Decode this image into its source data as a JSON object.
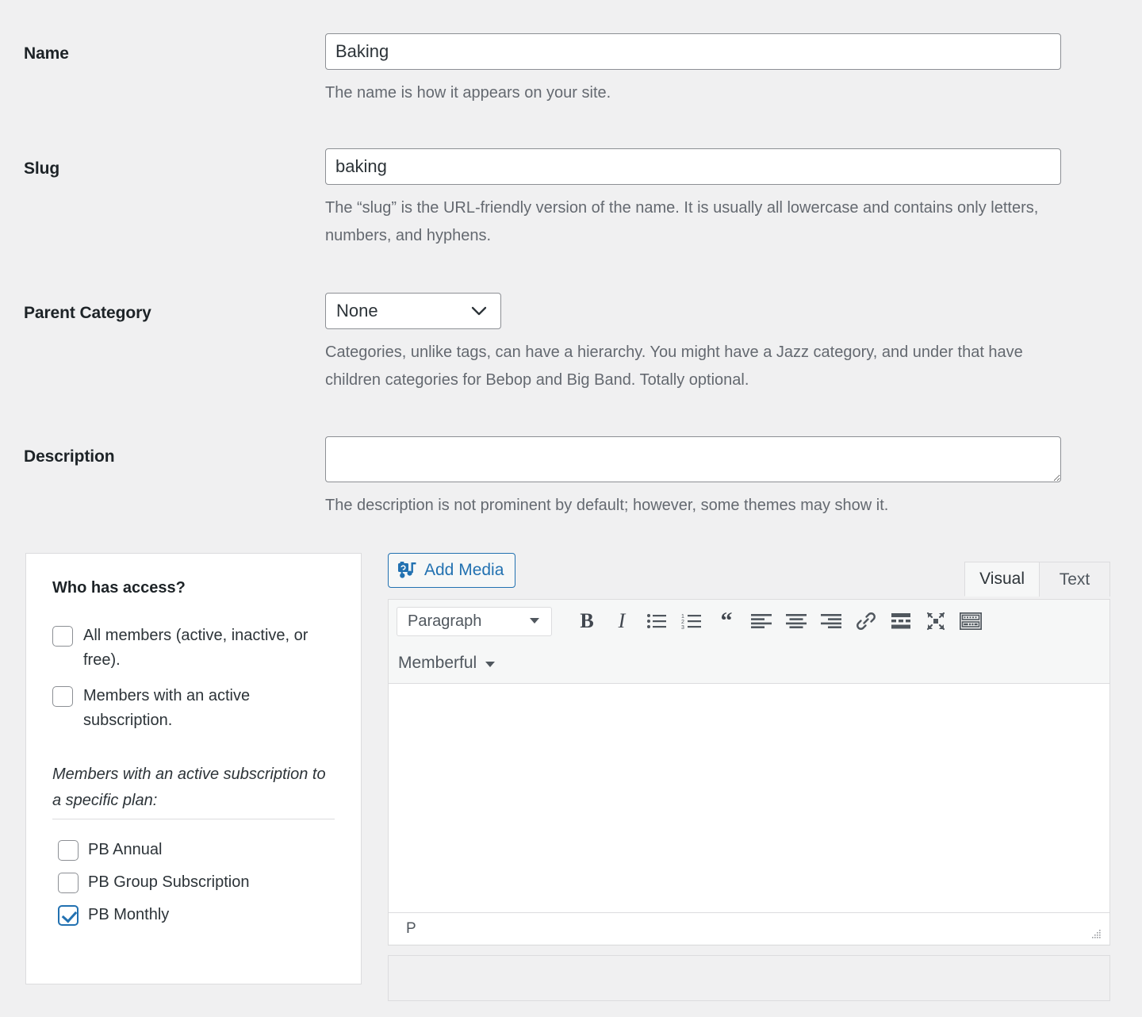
{
  "form": {
    "fields": [
      {
        "label": "Name",
        "value": "Baking",
        "help": "The name is how it appears on your site."
      },
      {
        "label": "Slug",
        "value": "baking",
        "help": "The “slug” is the URL-friendly version of the name. It is usually all lowercase and contains only letters, numbers, and hyphens."
      },
      {
        "label": "Parent Category",
        "value": "None",
        "help": "Categories, unlike tags, can have a hierarchy. You might have a Jazz category, and under that have children categories for Bebop and Big Band. Totally optional."
      },
      {
        "label": "Description",
        "value": "",
        "help": "The description is not prominent by default; however, some themes may show it."
      }
    ]
  },
  "access_panel": {
    "title": "Who has access?",
    "options": [
      {
        "label": "All members (active, inactive, or free).",
        "checked": false
      },
      {
        "label": "Members with an active subscription.",
        "checked": false
      }
    ],
    "plan_note": "Members with an active subscription to a specific plan:",
    "plans": [
      {
        "label": "PB Annual",
        "checked": false
      },
      {
        "label": "PB Group Subscription",
        "checked": false
      },
      {
        "label": "PB Monthly",
        "checked": true
      }
    ]
  },
  "editor": {
    "add_media_label": "Add Media",
    "tabs": [
      {
        "label": "Visual",
        "active": true
      },
      {
        "label": "Text",
        "active": false
      }
    ],
    "format_select": "Paragraph",
    "memberful_label": "Memberful",
    "status_path": "P",
    "content": ""
  },
  "colors": {
    "accent": "#2271b1",
    "page_bg": "#f0f0f1",
    "border": "#dcdcde",
    "input_border": "#8c8f94",
    "text": "#1d2327",
    "muted_text": "#646970"
  }
}
